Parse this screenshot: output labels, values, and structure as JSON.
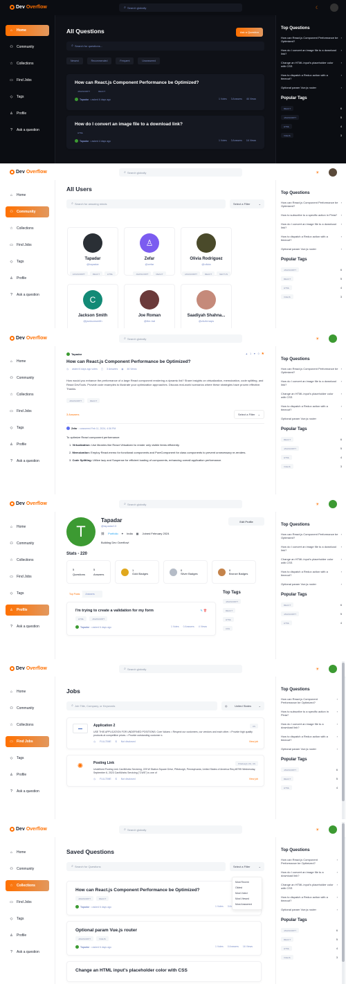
{
  "brand": {
    "name_a": "Dev",
    "name_b": "Overflow"
  },
  "search": {
    "placeholder": "Search globally"
  },
  "sidebar": {
    "items": [
      "Home",
      "Community",
      "Collections",
      "Find Jobs",
      "Tags",
      "Profile",
      "Ask a question"
    ]
  },
  "right": {
    "top_title": "Top Questions",
    "top_questions_a": [
      "How can React.js Component Performance be Optimized?",
      "How do I convert an image file to a download link?",
      "Change an HTML input's placeholder color with CSS",
      "How to dispatch a Redux action with a timeout?",
      "Optional param Vue.js router"
    ],
    "top_questions_b": [
      "How can React.js Component Performance be Optimized?",
      "How to subscribe to a specific action in Pinia?",
      "How do I convert an image file to a download link?",
      "How to dispatch a Redux action with a timeout?",
      "Optional param Vue.js router"
    ],
    "popular_title": "Popular Tags",
    "popular_tags": [
      {
        "tag": "react",
        "count": "6"
      },
      {
        "tag": "javascript",
        "count": "5"
      },
      {
        "tag": "html",
        "count": "4"
      },
      {
        "tag": "vuejs",
        "count": "3"
      }
    ]
  },
  "home": {
    "title": "All Questions",
    "ask_button": "Ask a Question",
    "search_placeholder": "Search for questions...",
    "filters": [
      "Newest",
      "Recommended",
      "Frequent",
      "Unanswered"
    ],
    "questions": [
      {
        "title": "How can React.js Component Performance be Optimized?",
        "tags": [
          "javascript",
          "react"
        ],
        "author": "Tapadar",
        "time": "• asked 6 days ago",
        "votes": "1 Votes",
        "answers": "3 Answers",
        "views": "46 Views"
      },
      {
        "title": "How do I convert an image file to a download link?",
        "tags": [
          "html"
        ],
        "author": "Tapadar",
        "time": "• asked 4 days ago",
        "votes": "1 Votes",
        "answers": "3 Answers",
        "views": "16 Views"
      }
    ]
  },
  "community": {
    "title": "All Users",
    "search_placeholder": "Search for amazing minds",
    "filter": "Select a Filter",
    "users": [
      {
        "name": "Tapadar",
        "handle": "@tapadar",
        "tags": [
          "javascript",
          "react",
          "html"
        ],
        "color": "#2a2f35"
      },
      {
        "name": "Zefar",
        "handle": "@zefar",
        "tags": [
          "javascript",
          "react"
        ],
        "color": "#7b5cf0"
      },
      {
        "name": "Olivia Rodriguez",
        "handle": "@olivia",
        "tags": [
          "javascript",
          "react",
          "next.js"
        ],
        "color": "#4a4a2a"
      },
      {
        "name": "Jackson Smith",
        "handle": "@jacksonsmith",
        "initial": "C",
        "tags": [],
        "color": "#138a76"
      },
      {
        "name": "Joe Roman",
        "handle": "@the-hal",
        "tags": [],
        "color": "#6b3a3a"
      },
      {
        "name": "Saadiyah Shahna...",
        "handle": "@zbzbmaps",
        "tags": [],
        "color": "#c58a7a"
      }
    ]
  },
  "detail": {
    "author": "Tapadar",
    "title": "How can React.js Component Performance be Optimized?",
    "asked": "asked 6 days ago votes",
    "answers": "3 Answers",
    "views": "46 Views",
    "votes": [
      "1",
      "0",
      "1",
      "0"
    ],
    "body": "How would you enhance the performance of a large React component rendering a dynamic list? Share insights on virtualization, memoization, code splitting, and React DevTools. Provide code examples to illustrate your optimization approaches. Discuss real-world scenarios where these strategies have proven effective. Thanks.",
    "tags": [
      "javascript",
      "react"
    ],
    "answers_count": "3 Answers",
    "filter": "Select a Filter",
    "answer_author": "Zefar",
    "answer_time": "• answered Feb 11, 2024, 4:36 PM",
    "answer_intro": "To optimize React component performance:",
    "points": [
      {
        "n": "1.",
        "h": "Virtualization:",
        "t": "Use libraries like React Virtualized to render only visible items efficiently."
      },
      {
        "n": "2.",
        "h": "Memoization:",
        "t": "Employ React.memo for functional components and PureComponent for class components to prevent unnecessary re-renders."
      },
      {
        "n": "3.",
        "h": "Code Splitting:",
        "t": "Utilize lazy and Suspense for efficient loading of components, enhancing overall application performance."
      }
    ]
  },
  "profile": {
    "initial": "T",
    "name": "Tapadar",
    "handle": "@tapadar13",
    "portfolio": "Portfolio",
    "location": "India",
    "joined": "Joined February 2024",
    "bio": "Building Dev Overflow!",
    "edit": "Edit Profile",
    "stats_title": "Stats - 220",
    "questions_n": "5",
    "questions_l": "Questions",
    "answers_n": "5",
    "answers_l": "Answers",
    "badges": [
      {
        "n": "1",
        "l": "Gold Badges",
        "c": "#e0a81e"
      },
      {
        "n": "0",
        "l": "Silver Badges",
        "c": "#b5bcc7"
      },
      {
        "n": "0",
        "l": "Bronze Badges",
        "c": "#c4834a"
      }
    ],
    "tabs": [
      "Top Posts",
      "Answers"
    ],
    "post": {
      "title": "I'm trying to create a validation for my form",
      "tags": [
        "html",
        "javascript"
      ],
      "author": "Tapadar",
      "time": "• asked 6 days ago",
      "votes": "1 Votes",
      "answers": "0 Answers",
      "views": "4 Views"
    },
    "top_tags_title": "Top Tags",
    "top_tags": [
      "javascript",
      "react",
      "html",
      "css",
      "vue"
    ]
  },
  "jobs": {
    "title": "Jobs",
    "search_placeholder": "Job Title, Company, or Keywords",
    "location": "United States",
    "list": [
      {
        "title": "Application 2",
        "loc": "US",
        "desc": "USE THIS APPLICATION FOR UNDEFINED POSITIONS: Core Values: • Respect our customers, our vendors and each other. • Provide high quality products at competitive prices. • Provide outstanding customer s",
        "type": "FULLTIME",
        "salary": "Not disclosed",
        "view": "View job"
      },
      {
        "title": "Posting Link",
        "loc": "Pittsburgh, PA, US",
        "desc": "Undefined Posting Link CardWorks Servicing, 225 W Station Square Drive, Pittsburgh, Pennsylvania, United States of America Req #8795 Wednesday, September 6, 2023 CardWorks Servicing (\"CWS\") is one of",
        "type": "FULLTIME",
        "salary": "Not disclosed",
        "view": "View job"
      }
    ]
  },
  "saved": {
    "title": "Saved Questions",
    "search_placeholder": "Search for Questions",
    "filter": "Select a Filter",
    "menu": [
      "Most Recent",
      "Oldest",
      "Most Voted",
      "Most Viewed",
      "Most Answered"
    ],
    "questions": [
      {
        "title": "How can React.js Component Performance be Optimized?",
        "tags": [
          "javascript",
          "react"
        ],
        "author": "Tapadar",
        "time": "• asked 6 days ago",
        "votes": "1 Votes",
        "answers": "3 Answers",
        "views": "46 Views"
      },
      {
        "title": "Optional param Vue.js router",
        "tags": [
          "javascript",
          "vuejs"
        ],
        "author": "Tapadar",
        "time": "• asked 6 days ago",
        "votes": "1 Votes",
        "answers": "0 Answers",
        "views": "16 Views"
      },
      {
        "title": "Change an HTML input's placeholder color with CSS",
        "tags": [],
        "author": "",
        "time": "",
        "votes": "",
        "answers": "",
        "views": ""
      }
    ]
  }
}
